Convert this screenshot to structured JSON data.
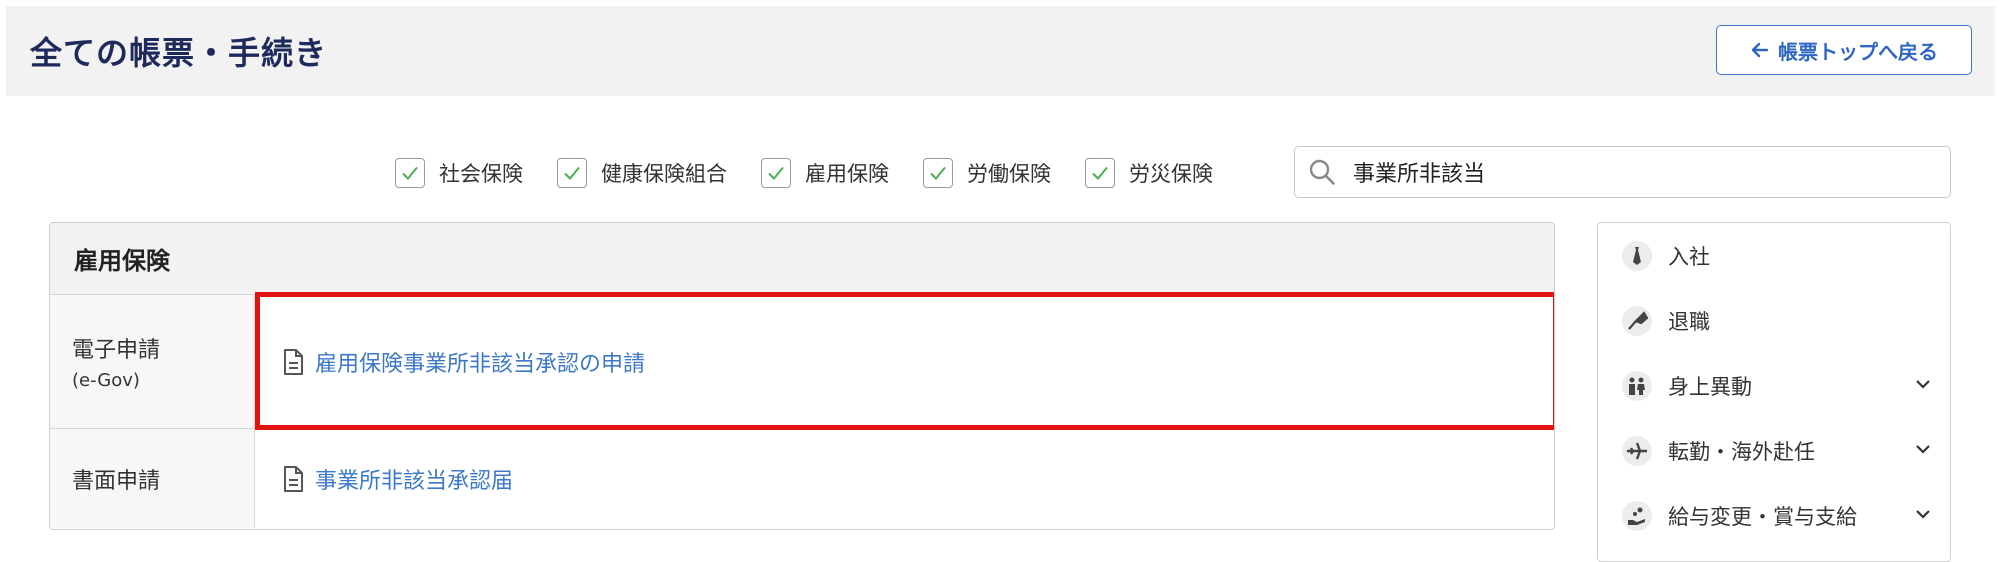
{
  "header": {
    "title": "全ての帳票・手続き",
    "back_label": "帳票トップへ戻る"
  },
  "filters": [
    {
      "label": "社会保険",
      "checked": true
    },
    {
      "label": "健康保険組合",
      "checked": true
    },
    {
      "label": "雇用保険",
      "checked": true
    },
    {
      "label": "労働保険",
      "checked": true
    },
    {
      "label": "労災保険",
      "checked": true
    }
  ],
  "search": {
    "value": "事業所非該当"
  },
  "panel": {
    "title": "雇用保険",
    "rows": [
      {
        "label": "電子申請",
        "sublabel": "(e-Gov)",
        "link": "雇用保険事業所非該当承認の申請"
      },
      {
        "label": "書面申請",
        "sublabel": "",
        "link": "事業所非該当承認届"
      }
    ]
  },
  "side": {
    "items": [
      {
        "label": "入社",
        "icon": "tie-icon",
        "expandable": false
      },
      {
        "label": "退職",
        "icon": "bouquet-icon",
        "expandable": false
      },
      {
        "label": "身上異動",
        "icon": "family-icon",
        "expandable": true
      },
      {
        "label": "転勤・海外赴任",
        "icon": "airplane-icon",
        "expandable": true
      },
      {
        "label": "給与変更・賞与支給",
        "icon": "money-hand-icon",
        "expandable": true
      }
    ]
  },
  "colors": {
    "accent": "#3c78c8",
    "title": "#1f2a5c",
    "highlight": "#e3130f",
    "check": "#4caf50"
  }
}
